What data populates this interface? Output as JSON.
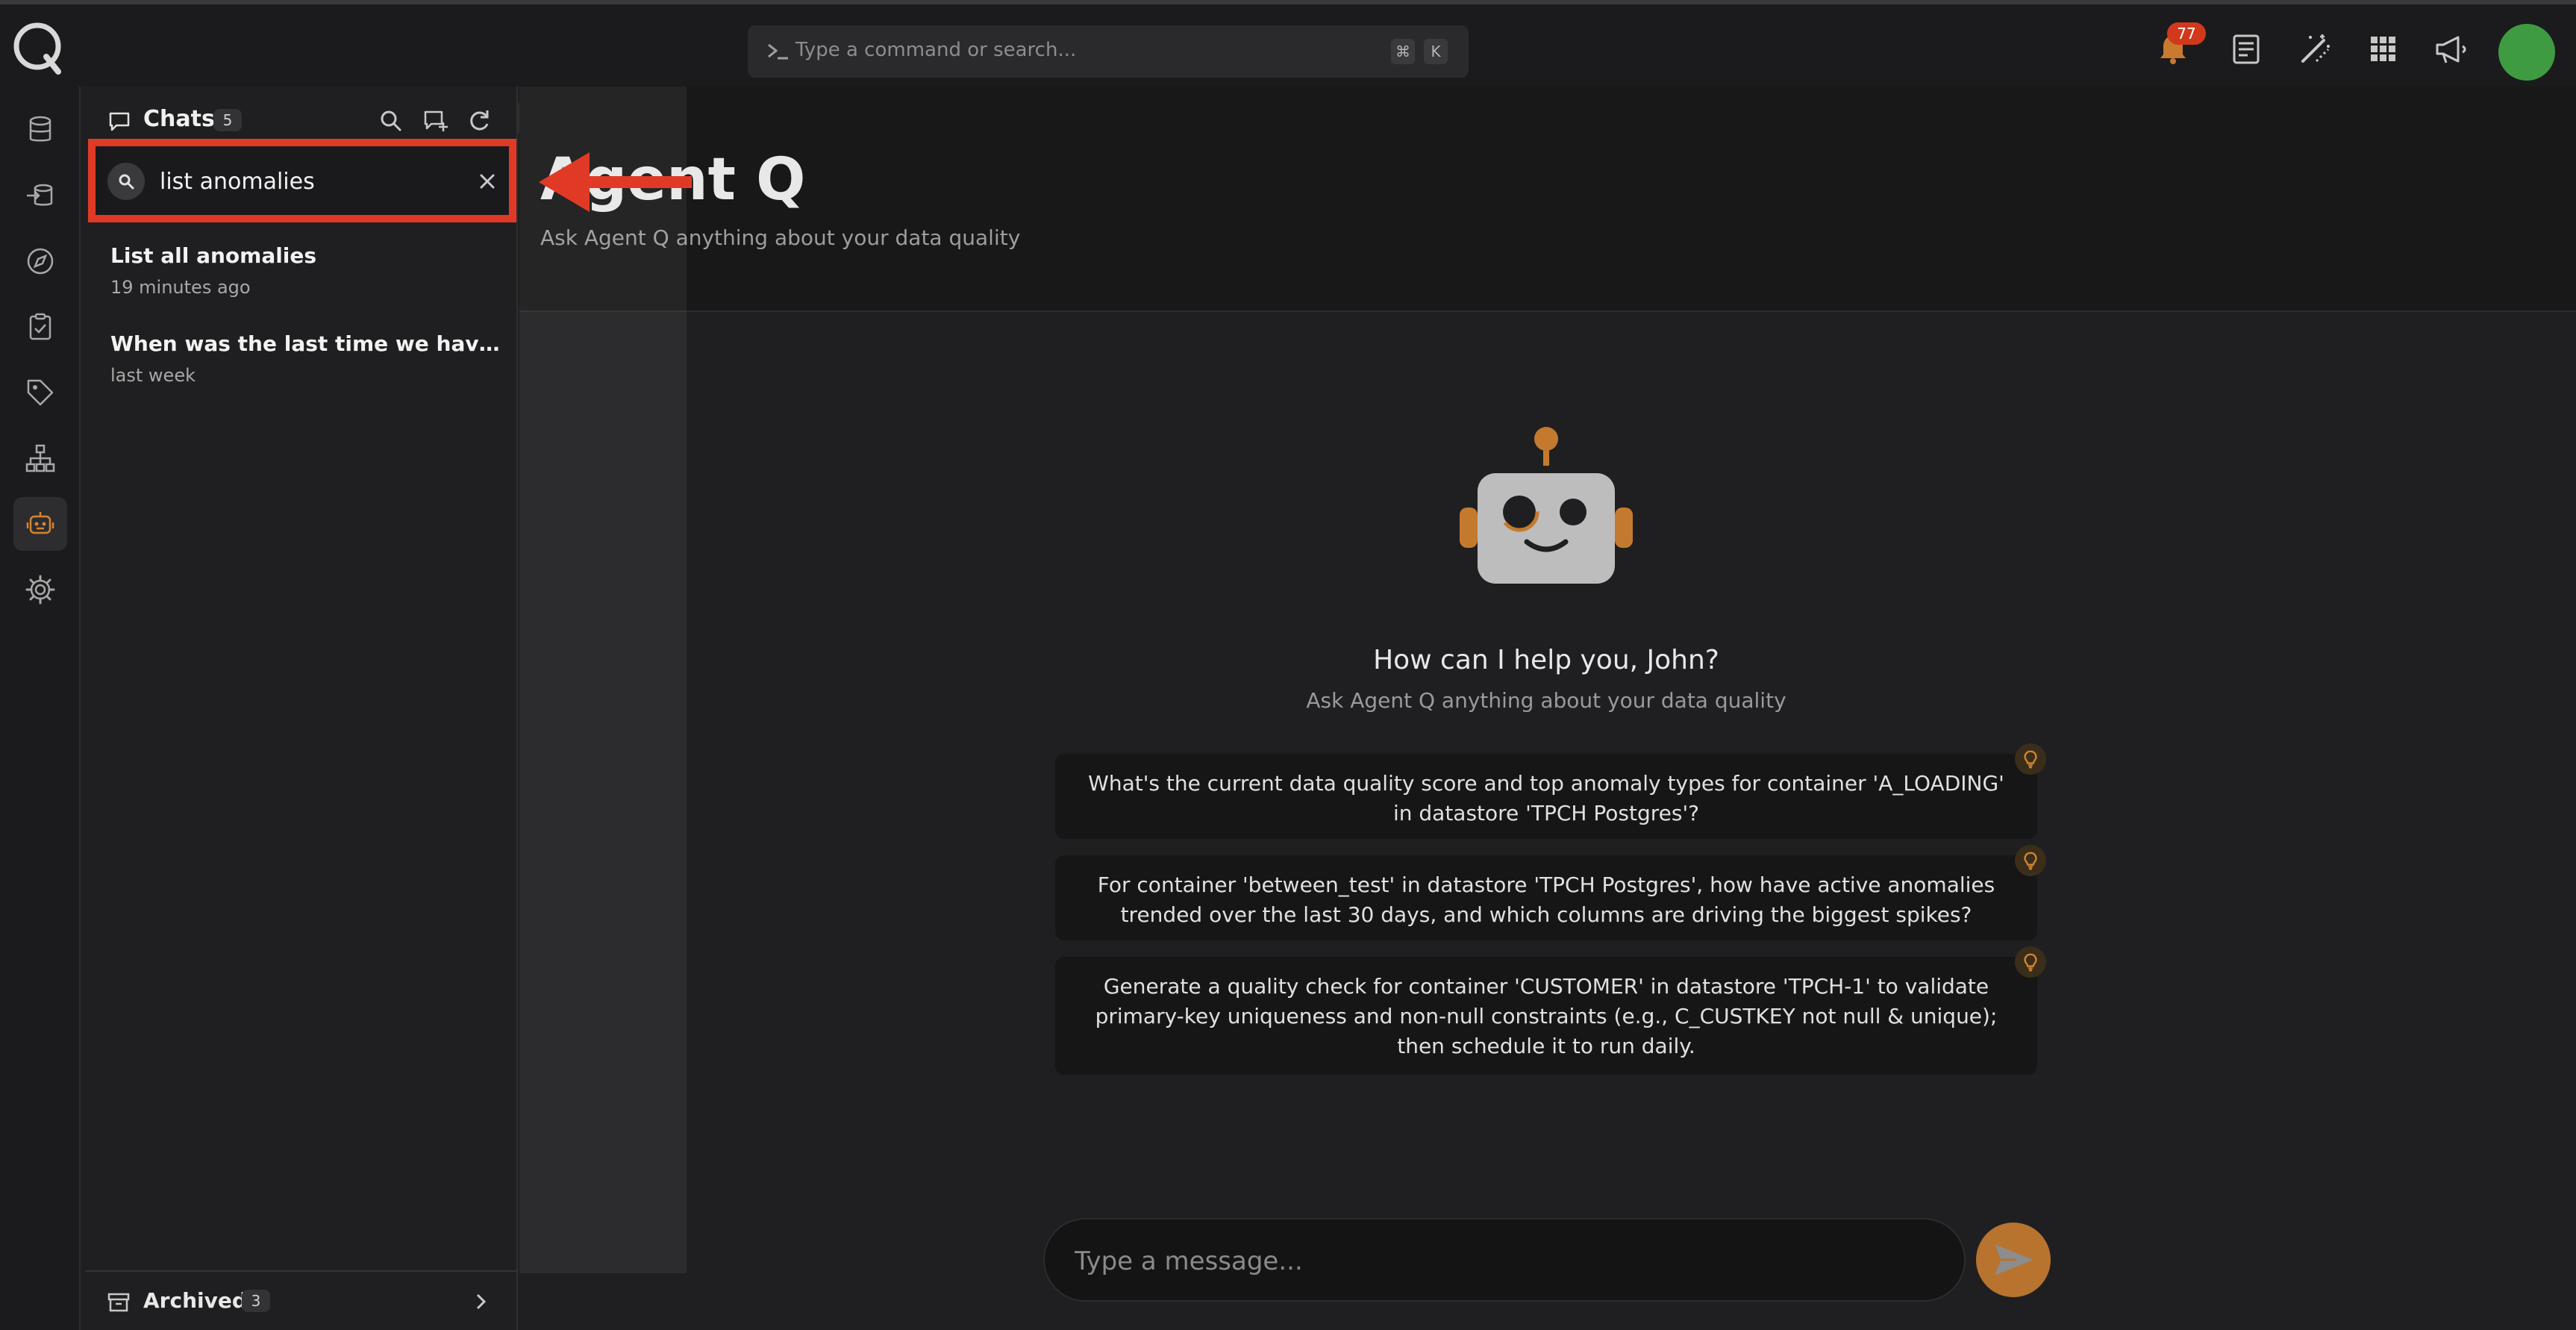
{
  "topbar": {
    "command_placeholder": "Type a command or search...",
    "shortcut_keys": [
      "⌘",
      "K"
    ],
    "notification_count": "77",
    "icons": [
      "bell-icon",
      "document-icon",
      "wand-icon",
      "grid-icon",
      "megaphone-icon"
    ]
  },
  "rail": {
    "items": [
      "database-icon",
      "inbound-icon",
      "compass-icon",
      "checklist-icon",
      "tag-icon",
      "hierarchy-icon",
      "robot-icon",
      "gear-icon"
    ],
    "active": "robot-icon"
  },
  "sidebar": {
    "title": "Chats",
    "count": "5",
    "search_value": "list anomalies",
    "chats": [
      {
        "title": "List all anomalies",
        "time": "19 minutes ago"
      },
      {
        "title": "When was the last time we have an ...",
        "time": "last week"
      }
    ],
    "archived_label": "Archived",
    "archived_count": "3"
  },
  "main": {
    "title": "Agent Q",
    "subtitle": "Ask Agent Q anything about your data quality",
    "greeting": "How can I help you, John?",
    "greeting_sub": "Ask Agent Q anything about your data quality",
    "suggestions": [
      "What's the current data quality score and top anomaly types for container 'A_LOADING' in datastore 'TPCH Postgres'?",
      "For container 'between_test' in datastore 'TPCH Postgres', how have active anomalies trended over the last 30 days, and which columns are driving the biggest spikes?",
      "Generate a quality check for container 'CUSTOMER' in datastore 'TPCH-1' to validate primary-key uniqueness and non-null constraints (e.g., C_CUSTKEY not null & unique); then schedule it to run daily."
    ],
    "message_placeholder": "Type a message..."
  },
  "colors": {
    "accent": "#b8732f",
    "highlight": "#e03a26",
    "avatar": "#3f9b42",
    "badge": "#d0391c"
  }
}
